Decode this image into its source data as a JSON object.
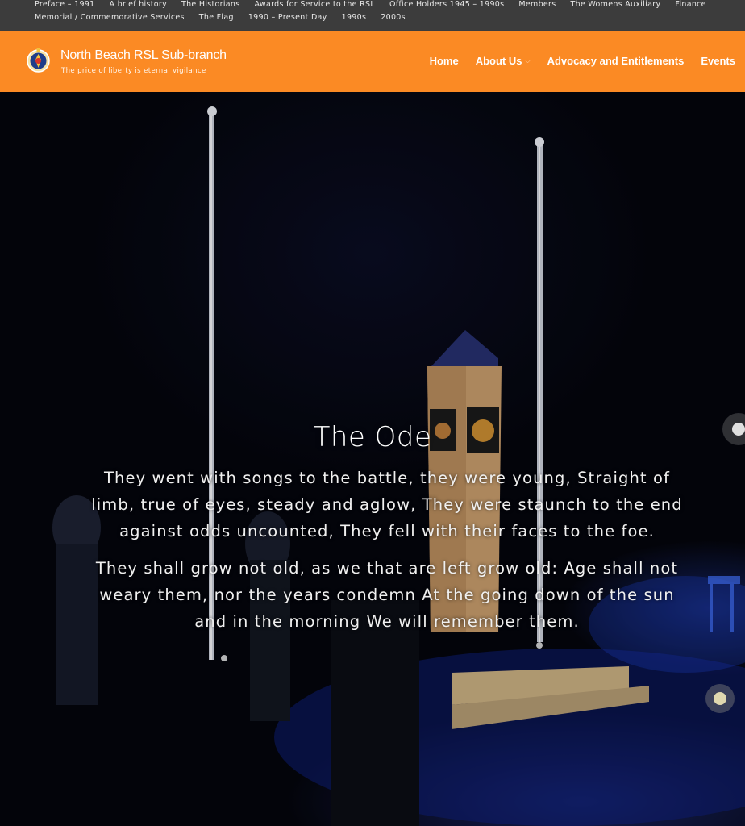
{
  "top_menu": {
    "row1": [
      "Preface – 1991",
      "A brief history",
      "The Historians",
      "Awards for Service to the RSL",
      "Office Holders 1945 – 1990s",
      "Members",
      "The Womens Auxiliary",
      "Finance"
    ],
    "row2": [
      "Memorial / Commemorative Services",
      "The Flag",
      "1990 – Present Day",
      "1990s",
      "2000s"
    ]
  },
  "header": {
    "site_title": "North Beach RSL Sub-branch",
    "tagline": "The price of liberty is eternal vigilance",
    "nav": {
      "home": "Home",
      "about": "About Us",
      "advocacy": "Advocacy and Entitlements",
      "events": "Events"
    }
  },
  "hero": {
    "title": "The Ode",
    "paragraph1": "They went with songs to the battle, they were young, Straight of limb, true of eyes, steady and aglow, They were staunch to the end against odds uncounted, They fell with their faces to the foe.",
    "paragraph2": "They shall grow not old, as we that are left grow old: Age shall not weary them, nor the years condemn At the going down of the sun and in the morning We will remember them."
  },
  "colors": {
    "topbar_bg": "#3c3c3c",
    "header_bg": "#fb8a24",
    "hero_bg": "#050712"
  }
}
